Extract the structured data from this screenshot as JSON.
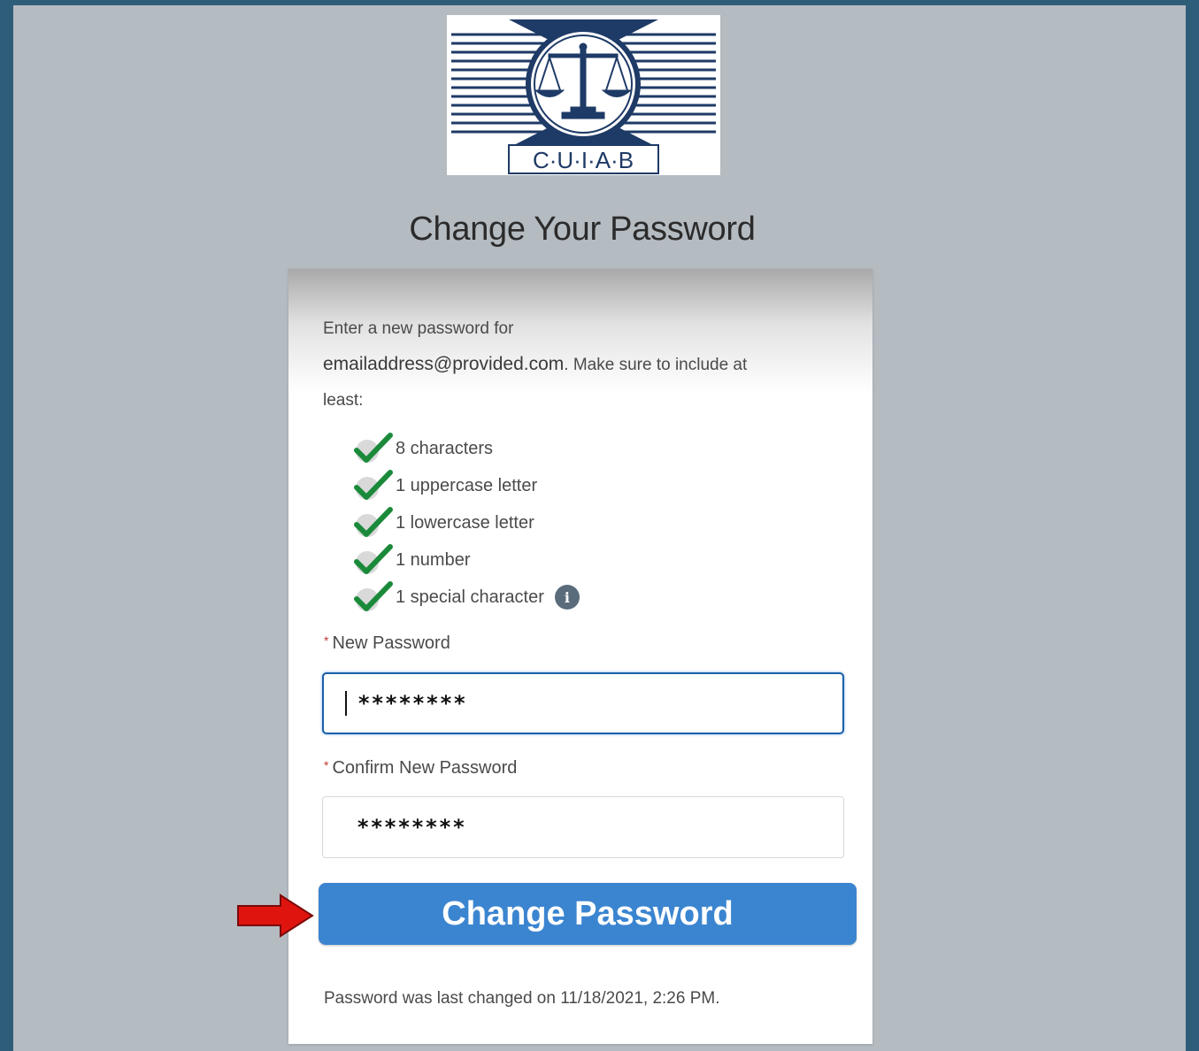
{
  "logo": {
    "text": "C·U·I·A·B"
  },
  "page_title": "Change Your Password",
  "intro": {
    "line1": "Enter a new password for",
    "email": "emailaddress@provided.com",
    "line2": ". Make sure to include at",
    "line3": "least:"
  },
  "requirements": [
    {
      "label": "8 characters",
      "met": true
    },
    {
      "label": "1 uppercase letter",
      "met": true
    },
    {
      "label": "1 lowercase letter",
      "met": true
    },
    {
      "label": "1 number",
      "met": true
    },
    {
      "label": "1 special character",
      "met": true
    }
  ],
  "info_icon_glyph": "i",
  "new_password": {
    "label": "New Password",
    "required_mark": "*",
    "value": "********"
  },
  "confirm_password": {
    "label": "Confirm New Password",
    "required_mark": "*",
    "value": "********"
  },
  "submit_label": "Change Password",
  "footer_note": "Password was last changed on 11/18/2021, 2:26 PM.",
  "colors": {
    "frame": "#2e5d79",
    "background": "#b4bbc1",
    "button": "#3b85d0",
    "check": "#1a8a3a",
    "arrow": "#e0140f",
    "logo_navy": "#1e3a66"
  }
}
